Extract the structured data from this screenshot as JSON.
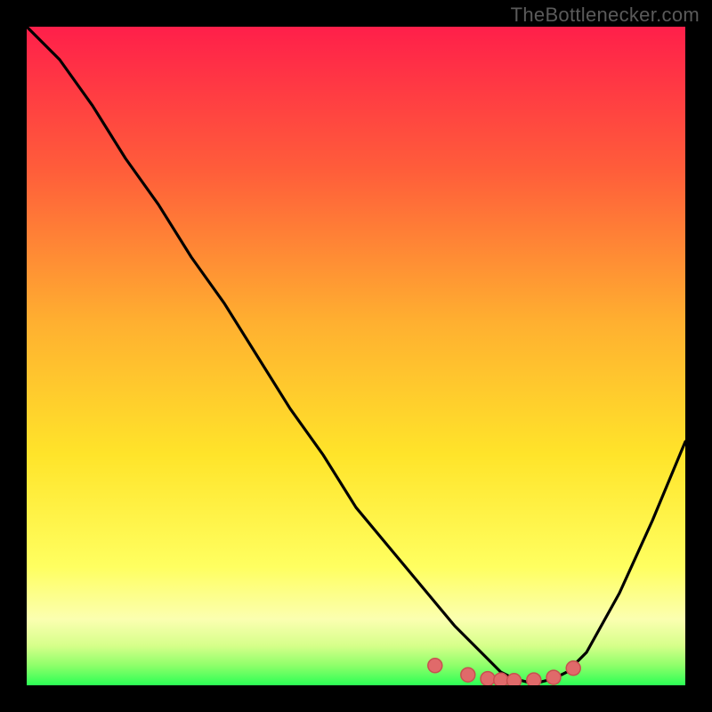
{
  "watermark": "TheBottlenecker.com",
  "colors": {
    "bg": "#000000",
    "top_gradient": "#ff1f4a",
    "mid1": "#ff6b2f",
    "mid2": "#ffd830",
    "lower": "#ffff70",
    "bottom": "#2cff55",
    "curve": "#000000",
    "dot_fill": "#e06a6a",
    "dot_ring": "#c85050"
  },
  "chart_data": {
    "type": "line",
    "title": "",
    "xlabel": "",
    "ylabel": "",
    "xlim": [
      0,
      100
    ],
    "ylim": [
      0,
      100
    ],
    "x": [
      0,
      5,
      10,
      15,
      20,
      25,
      30,
      35,
      40,
      45,
      50,
      55,
      60,
      65,
      70,
      72,
      74,
      76,
      78,
      80,
      82,
      85,
      90,
      95,
      100
    ],
    "y": [
      100,
      95,
      88,
      80,
      73,
      65,
      58,
      50,
      42,
      35,
      27,
      21,
      15,
      9,
      4,
      2,
      1,
      0.5,
      0.5,
      1,
      2,
      5,
      14,
      25,
      37
    ],
    "minimum_x": 77,
    "dots": [
      {
        "x": 62,
        "y": 3
      },
      {
        "x": 67,
        "y": 1.6
      },
      {
        "x": 70,
        "y": 1
      },
      {
        "x": 72,
        "y": 0.8
      },
      {
        "x": 74,
        "y": 0.7
      },
      {
        "x": 77,
        "y": 0.8
      },
      {
        "x": 80,
        "y": 1.2
      },
      {
        "x": 83,
        "y": 2.6
      }
    ]
  }
}
